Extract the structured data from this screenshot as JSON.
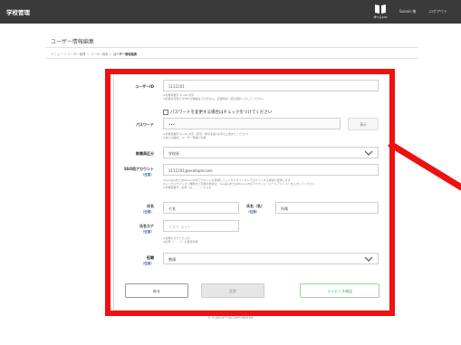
{
  "header": {
    "title": "学校管理",
    "logo_text": "学べる100",
    "user": "Sasaki 様",
    "logout": "ログアウト"
  },
  "page": {
    "title": "ユーザー情報編集",
    "breadcrumb": {
      "items": [
        "メニュー",
        "ユーザー管理",
        "ユーザー検索",
        "ユーザー情報編集"
      ],
      "separators": [
        "＞",
        "＞",
        "＞"
      ]
    }
  },
  "form": {
    "user_id": {
      "label": "ユーザーID",
      "value": "1111101",
      "help": [
        "※半角英数字 4〜16 文字",
        "※変更は可能ですがIDの重複はできません。変更時は一意の値を入力してください。"
      ]
    },
    "password": {
      "label": "パスワード",
      "checkbox_label": "パスワードを変更する場合はチェックをつけてください",
      "value": "•••",
      "show_button": "表示",
      "help": [
        "※半角英数字 4〜16 文字（英字・数字を各1文字以上含めてください）",
        "※本人の確認、ユーザー登録に利用"
      ]
    },
    "school_category": {
      "label": "教職員区分",
      "value": "学校長"
    },
    "sso": {
      "label": "SSO用アカウント",
      "required": "（任意）",
      "value": "1111101@example.com",
      "help": [
        "※GoogleまたはMicrosoftのアカウントを登録してシングルサインオンでログインする場合に使用します",
        "※シングルサインオン機能をご利用の場合は、GoogleまたはMicrosoftのアカウント（メールアドレス）を入力してください",
        "※半角英数字、記号（@ ＿ - . ）で入力"
      ]
    },
    "name": {
      "label": "氏名",
      "required": "（任意）",
      "value": "七名",
      "first_label": "氏名（名）",
      "first_required": "（任意）",
      "first_value": "所属"
    },
    "kana": {
      "label": "氏名カナ",
      "required": "（任意）",
      "placeholder": "ミスト エイト",
      "help": [
        "※全角カタカナで入力",
        "※記号（・、ー）も使用可能"
      ]
    },
    "position": {
      "label": "役職",
      "required": "（任意）",
      "value": "教頭"
    }
  },
  "buttons": {
    "back": "戻る",
    "change": "変更",
    "license": "ライセンス確認"
  },
  "footer": {
    "copyright": "© FUJISOFT INCORPORATED"
  },
  "colors": {
    "header_bg": "#3a3a3a",
    "annotation_red": "#ee1111",
    "required_blue": "#3a6fc4",
    "license_green": "#4caf50"
  }
}
